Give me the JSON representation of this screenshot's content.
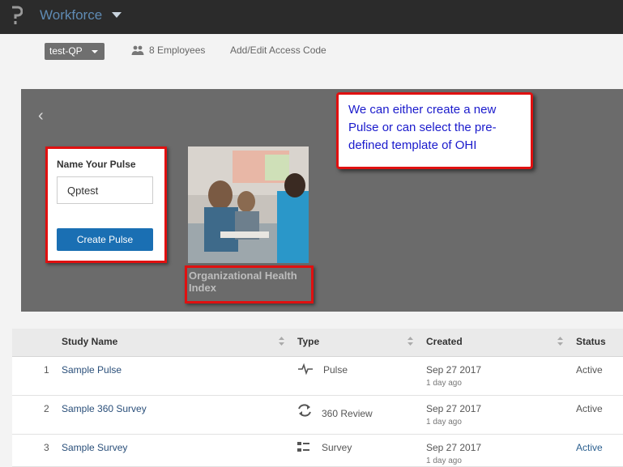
{
  "topbar": {
    "app_title": "Workforce"
  },
  "subbar": {
    "org_selected": "test-QP",
    "employees": "8 Employees",
    "access_link": "Add/Edit Access Code"
  },
  "panel": {
    "back": "‹",
    "name_label": "Name Your Pulse",
    "name_value": "Qptest",
    "create_button": "Create Pulse",
    "template_label": "Organizational Health Index"
  },
  "callout": {
    "text": "We can either create a new Pulse or can select the pre-defined template of OHI"
  },
  "table": {
    "headers": {
      "name": "Study Name",
      "type": "Type",
      "created": "Created",
      "status": "Status"
    },
    "rows": [
      {
        "num": "1",
        "name": "Sample Pulse",
        "type": "Pulse",
        "type_icon": "pulse-icon",
        "date": "Sep 27 2017",
        "ago": "1 day ago",
        "status": "Active"
      },
      {
        "num": "2",
        "name": "Sample 360 Survey",
        "type": "360 Review",
        "type_icon": "refresh-icon",
        "date": "Sep 27 2017",
        "ago": "1 day ago",
        "status": "Active"
      },
      {
        "num": "3",
        "name": "Sample Survey",
        "type": "Survey",
        "type_icon": "list-icon",
        "date": "Sep 27 2017",
        "ago": "1 day ago",
        "status": "Active"
      }
    ]
  },
  "colors": {
    "topbar": "#2b2b2b",
    "accent": "#1a6fb3",
    "annotation_border": "#e01010",
    "callout_text": "#1a1acc"
  }
}
